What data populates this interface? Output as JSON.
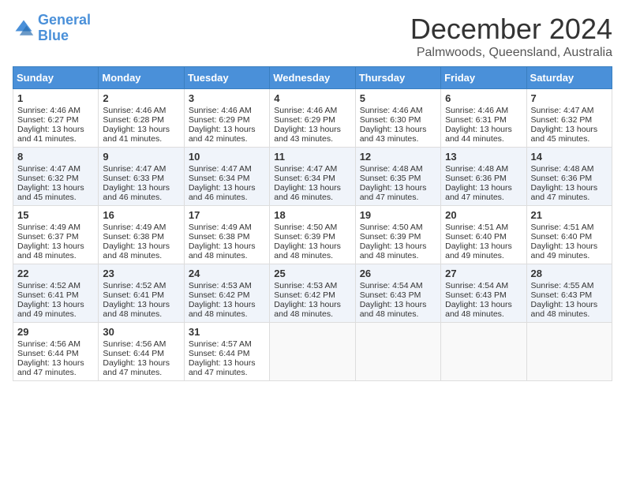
{
  "header": {
    "logo_line1": "General",
    "logo_line2": "Blue",
    "title": "December 2024",
    "subtitle": "Palmwoods, Queensland, Australia"
  },
  "calendar": {
    "days_of_week": [
      "Sunday",
      "Monday",
      "Tuesday",
      "Wednesday",
      "Thursday",
      "Friday",
      "Saturday"
    ],
    "weeks": [
      [
        {
          "day": "1",
          "sunrise": "Sunrise: 4:46 AM",
          "sunset": "Sunset: 6:27 PM",
          "daylight": "Daylight: 13 hours and 41 minutes."
        },
        {
          "day": "2",
          "sunrise": "Sunrise: 4:46 AM",
          "sunset": "Sunset: 6:28 PM",
          "daylight": "Daylight: 13 hours and 41 minutes."
        },
        {
          "day": "3",
          "sunrise": "Sunrise: 4:46 AM",
          "sunset": "Sunset: 6:29 PM",
          "daylight": "Daylight: 13 hours and 42 minutes."
        },
        {
          "day": "4",
          "sunrise": "Sunrise: 4:46 AM",
          "sunset": "Sunset: 6:29 PM",
          "daylight": "Daylight: 13 hours and 43 minutes."
        },
        {
          "day": "5",
          "sunrise": "Sunrise: 4:46 AM",
          "sunset": "Sunset: 6:30 PM",
          "daylight": "Daylight: 13 hours and 43 minutes."
        },
        {
          "day": "6",
          "sunrise": "Sunrise: 4:46 AM",
          "sunset": "Sunset: 6:31 PM",
          "daylight": "Daylight: 13 hours and 44 minutes."
        },
        {
          "day": "7",
          "sunrise": "Sunrise: 4:47 AM",
          "sunset": "Sunset: 6:32 PM",
          "daylight": "Daylight: 13 hours and 45 minutes."
        }
      ],
      [
        {
          "day": "8",
          "sunrise": "Sunrise: 4:47 AM",
          "sunset": "Sunset: 6:32 PM",
          "daylight": "Daylight: 13 hours and 45 minutes."
        },
        {
          "day": "9",
          "sunrise": "Sunrise: 4:47 AM",
          "sunset": "Sunset: 6:33 PM",
          "daylight": "Daylight: 13 hours and 46 minutes."
        },
        {
          "day": "10",
          "sunrise": "Sunrise: 4:47 AM",
          "sunset": "Sunset: 6:34 PM",
          "daylight": "Daylight: 13 hours and 46 minutes."
        },
        {
          "day": "11",
          "sunrise": "Sunrise: 4:47 AM",
          "sunset": "Sunset: 6:34 PM",
          "daylight": "Daylight: 13 hours and 46 minutes."
        },
        {
          "day": "12",
          "sunrise": "Sunrise: 4:48 AM",
          "sunset": "Sunset: 6:35 PM",
          "daylight": "Daylight: 13 hours and 47 minutes."
        },
        {
          "day": "13",
          "sunrise": "Sunrise: 4:48 AM",
          "sunset": "Sunset: 6:36 PM",
          "daylight": "Daylight: 13 hours and 47 minutes."
        },
        {
          "day": "14",
          "sunrise": "Sunrise: 4:48 AM",
          "sunset": "Sunset: 6:36 PM",
          "daylight": "Daylight: 13 hours and 47 minutes."
        }
      ],
      [
        {
          "day": "15",
          "sunrise": "Sunrise: 4:49 AM",
          "sunset": "Sunset: 6:37 PM",
          "daylight": "Daylight: 13 hours and 48 minutes."
        },
        {
          "day": "16",
          "sunrise": "Sunrise: 4:49 AM",
          "sunset": "Sunset: 6:38 PM",
          "daylight": "Daylight: 13 hours and 48 minutes."
        },
        {
          "day": "17",
          "sunrise": "Sunrise: 4:49 AM",
          "sunset": "Sunset: 6:38 PM",
          "daylight": "Daylight: 13 hours and 48 minutes."
        },
        {
          "day": "18",
          "sunrise": "Sunrise: 4:50 AM",
          "sunset": "Sunset: 6:39 PM",
          "daylight": "Daylight: 13 hours and 48 minutes."
        },
        {
          "day": "19",
          "sunrise": "Sunrise: 4:50 AM",
          "sunset": "Sunset: 6:39 PM",
          "daylight": "Daylight: 13 hours and 48 minutes."
        },
        {
          "day": "20",
          "sunrise": "Sunrise: 4:51 AM",
          "sunset": "Sunset: 6:40 PM",
          "daylight": "Daylight: 13 hours and 49 minutes."
        },
        {
          "day": "21",
          "sunrise": "Sunrise: 4:51 AM",
          "sunset": "Sunset: 6:40 PM",
          "daylight": "Daylight: 13 hours and 49 minutes."
        }
      ],
      [
        {
          "day": "22",
          "sunrise": "Sunrise: 4:52 AM",
          "sunset": "Sunset: 6:41 PM",
          "daylight": "Daylight: 13 hours and 49 minutes."
        },
        {
          "day": "23",
          "sunrise": "Sunrise: 4:52 AM",
          "sunset": "Sunset: 6:41 PM",
          "daylight": "Daylight: 13 hours and 48 minutes."
        },
        {
          "day": "24",
          "sunrise": "Sunrise: 4:53 AM",
          "sunset": "Sunset: 6:42 PM",
          "daylight": "Daylight: 13 hours and 48 minutes."
        },
        {
          "day": "25",
          "sunrise": "Sunrise: 4:53 AM",
          "sunset": "Sunset: 6:42 PM",
          "daylight": "Daylight: 13 hours and 48 minutes."
        },
        {
          "day": "26",
          "sunrise": "Sunrise: 4:54 AM",
          "sunset": "Sunset: 6:43 PM",
          "daylight": "Daylight: 13 hours and 48 minutes."
        },
        {
          "day": "27",
          "sunrise": "Sunrise: 4:54 AM",
          "sunset": "Sunset: 6:43 PM",
          "daylight": "Daylight: 13 hours and 48 minutes."
        },
        {
          "day": "28",
          "sunrise": "Sunrise: 4:55 AM",
          "sunset": "Sunset: 6:43 PM",
          "daylight": "Daylight: 13 hours and 48 minutes."
        }
      ],
      [
        {
          "day": "29",
          "sunrise": "Sunrise: 4:56 AM",
          "sunset": "Sunset: 6:44 PM",
          "daylight": "Daylight: 13 hours and 47 minutes."
        },
        {
          "day": "30",
          "sunrise": "Sunrise: 4:56 AM",
          "sunset": "Sunset: 6:44 PM",
          "daylight": "Daylight: 13 hours and 47 minutes."
        },
        {
          "day": "31",
          "sunrise": "Sunrise: 4:57 AM",
          "sunset": "Sunset: 6:44 PM",
          "daylight": "Daylight: 13 hours and 47 minutes."
        },
        null,
        null,
        null,
        null
      ]
    ]
  }
}
